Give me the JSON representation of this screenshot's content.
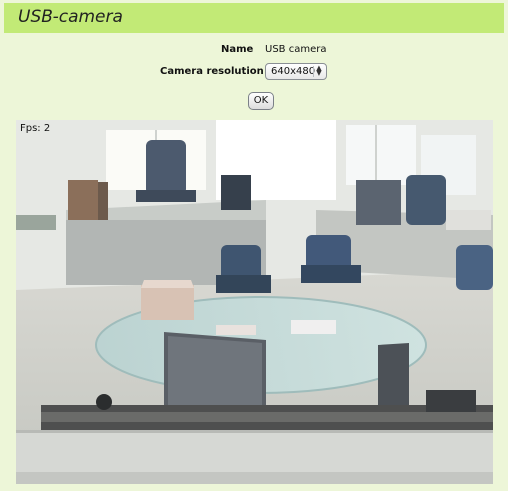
{
  "header": {
    "title": "USB-camera"
  },
  "form": {
    "name_label": "Name",
    "name_value": "USB camera",
    "resolution_label": "Camera resolution",
    "resolution_value": "640x480",
    "ok_label": "OK"
  },
  "video": {
    "fps_label": "Fps: 2"
  },
  "icons": {
    "spinner": "up-down-arrows-icon"
  }
}
